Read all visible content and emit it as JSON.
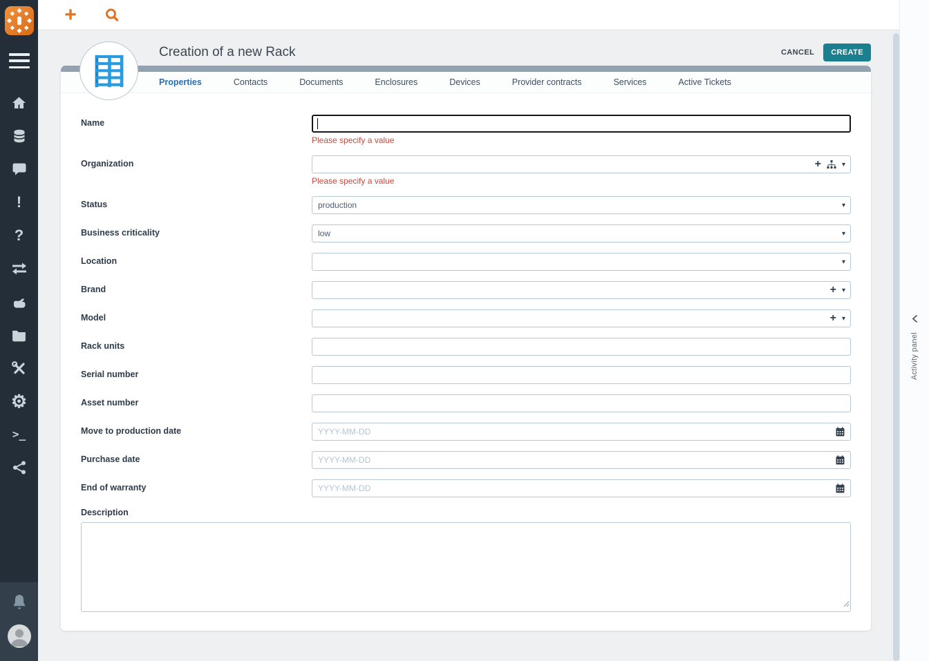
{
  "colors": {
    "sidebar-bg": "#232e38",
    "accent-orange": "#e4731f",
    "create-teal": "#1a7f8e",
    "tab-active": "#2a6cb5",
    "error-red": "#c3493d",
    "rack-blue": "#2b9be0"
  },
  "topbar": {
    "icons": [
      "plus",
      "search"
    ]
  },
  "sidebar": {
    "items": [
      {
        "icon": "home"
      },
      {
        "icon": "database"
      },
      {
        "icon": "chat"
      },
      {
        "icon": "exclamation"
      },
      {
        "icon": "question"
      },
      {
        "icon": "arrows-swap"
      },
      {
        "icon": "hand"
      },
      {
        "icon": "folder"
      },
      {
        "icon": "tools"
      },
      {
        "icon": "gear"
      },
      {
        "icon": "terminal"
      },
      {
        "icon": "share"
      }
    ],
    "bottom": [
      "bell",
      "avatar"
    ]
  },
  "header": {
    "title": "Creation of a new Rack",
    "cancel": "CANCEL",
    "create": "CREATE"
  },
  "tabs": [
    {
      "label": "Properties",
      "active": true
    },
    {
      "label": "Contacts",
      "active": false
    },
    {
      "label": "Documents",
      "active": false
    },
    {
      "label": "Enclosures",
      "active": false
    },
    {
      "label": "Devices",
      "active": false
    },
    {
      "label": "Provider contracts",
      "active": false
    },
    {
      "label": "Services",
      "active": false
    },
    {
      "label": "Active Tickets",
      "active": false
    }
  ],
  "form": {
    "fields": [
      {
        "label": "Name",
        "type": "text",
        "value": "",
        "focused": true,
        "error": "Please specify a value"
      },
      {
        "label": "Organization",
        "type": "org",
        "value": "",
        "error": "Please specify a value"
      },
      {
        "label": "Status",
        "type": "select",
        "value": "production"
      },
      {
        "label": "Business criticality",
        "type": "select",
        "value": "low"
      },
      {
        "label": "Location",
        "type": "select",
        "value": ""
      },
      {
        "label": "Brand",
        "type": "add",
        "value": ""
      },
      {
        "label": "Model",
        "type": "add",
        "value": ""
      },
      {
        "label": "Rack units",
        "type": "text",
        "value": ""
      },
      {
        "label": "Serial number",
        "type": "text",
        "value": ""
      },
      {
        "label": "Asset number",
        "type": "text",
        "value": ""
      },
      {
        "label": "Move to production date",
        "type": "date",
        "value": "",
        "placeholder": "YYYY-MM-DD"
      },
      {
        "label": "Purchase date",
        "type": "date",
        "value": "",
        "placeholder": "YYYY-MM-DD"
      },
      {
        "label": "End of warranty",
        "type": "date",
        "value": "",
        "placeholder": "YYYY-MM-DD"
      },
      {
        "label": "Description",
        "type": "textarea",
        "value": ""
      }
    ]
  },
  "activity_panel": {
    "label": "Activity panel"
  }
}
